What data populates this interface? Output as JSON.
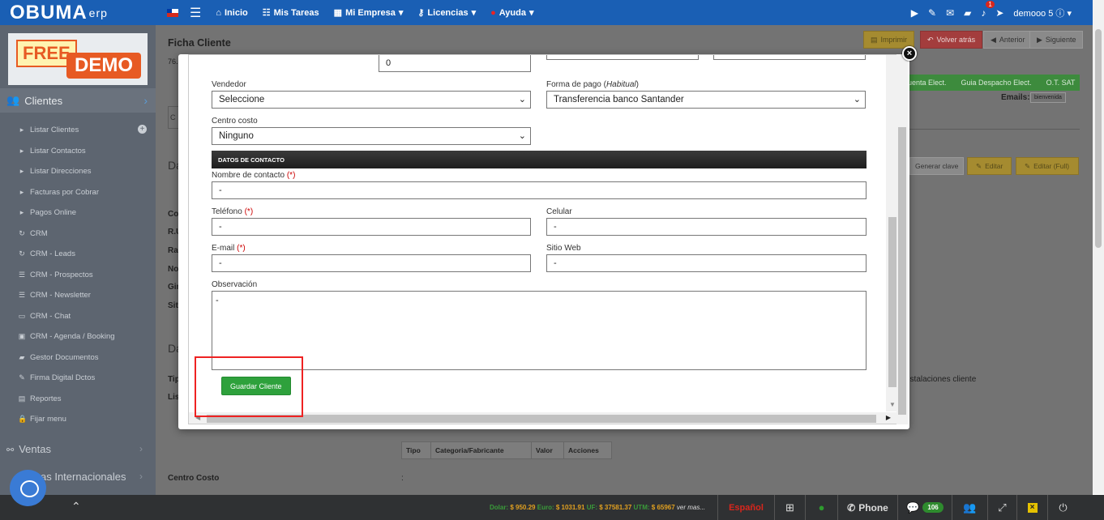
{
  "topbar": {
    "logo_main": "OBUMA",
    "logo_sub": "erp",
    "nav": [
      "Inicio",
      "Mis Tareas",
      "Mi Empresa",
      "Licencias",
      "Ayuda"
    ],
    "notif_count": "1",
    "user": "demooo 5"
  },
  "sidebar": {
    "demo_free": "FREE",
    "demo_label": "DEMO",
    "head": "Clientes",
    "items": [
      "Listar Clientes",
      "Listar Contactos",
      "Listar Direcciones",
      "Facturas por Cobrar",
      "Pagos Online",
      "CRM",
      "CRM - Leads",
      "CRM - Prospectos",
      "CRM - Newsletter",
      "CRM - Chat",
      "CRM - Agenda / Booking",
      "Gestor Documentos",
      "Firma Digital Dctos",
      "Reportes",
      "Fijar menu"
    ],
    "sections": [
      "Ventas",
      "as Internacionales"
    ]
  },
  "background": {
    "title": "Ficha Cliente",
    "subtitle": "76.",
    "btn_imprimir": "Imprimir",
    "btn_volver": "Volver atrás",
    "btn_anterior": "Anterior",
    "btn_siguiente": "Siguiente",
    "greenbar": [
      "uenta Elect.",
      "Guia Despacho Elect.",
      "O.T. SAT"
    ],
    "emails_label": "Emails:",
    "emails_value": "bienvenida",
    "btn_genclave": "Generar clave",
    "btn_editar": "Editar",
    "btn_editar_full": "Editar (Full)",
    "installaciones": "nstalaciones cliente",
    "section1": "Da",
    "section2": "Da",
    "labels": [
      "Co",
      "R.U",
      "Ra",
      "No",
      "Gir",
      "Sit",
      "Tip",
      "Lis"
    ],
    "table_headers": [
      "Tipo",
      "Categoria/Fabricante",
      "Valor",
      "Acciones"
    ],
    "centro_costo": "Centro Costo",
    "colon": ":"
  },
  "modal": {
    "top_value": "0",
    "vendedor_label": "Vendedor",
    "vendedor_value": "Seleccione",
    "forma_pago_label": "Forma de pago",
    "forma_pago_hint": "Habitual",
    "forma_pago_value": "Transferencia banco Santander",
    "centro_costo_label": "Centro costo",
    "centro_costo_value": "Ninguno",
    "section_header": "DATOS DE CONTACTO",
    "nombre_contacto_label": "Nombre de contacto",
    "nombre_contacto_value": "-",
    "telefono_label": "Teléfono",
    "telefono_value": "-",
    "celular_label": "Celular",
    "celular_value": "-",
    "email_label": "E-mail",
    "email_value": "-",
    "sitio_web_label": "Sitio Web",
    "sitio_web_value": "-",
    "observacion_label": "Observación",
    "observacion_value": "-",
    "required_mark": "(*)",
    "save_button": "Guardar Cliente"
  },
  "bottombar": {
    "dolar_label": "Dolar:",
    "dolar_value": "$ 950.29",
    "euro_label": "Euro:",
    "euro_value": "$ 1031.91",
    "uf_label": "UF:",
    "uf_value": "$ 37581.37",
    "utm_label": "UTM:",
    "utm_value": "$ 65967",
    "more": "ver mas...",
    "language": "Español",
    "phone": "Phone",
    "chat_count": "106"
  },
  "colors": {
    "topbar": "#1a5fb4",
    "save_button": "#2ea13c",
    "highlight": "#e22222",
    "sidebar": "#5d6570"
  }
}
